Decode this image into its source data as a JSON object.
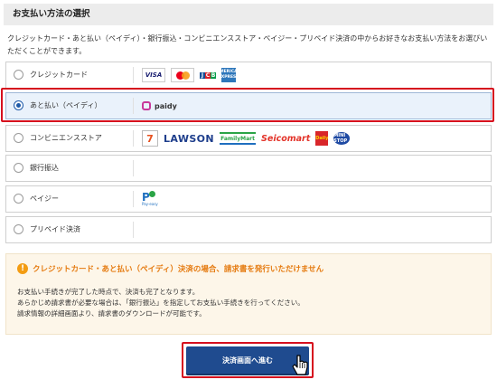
{
  "header": {
    "title": "お支払い方法の選択"
  },
  "intro": "クレジットカード・あと払い（ペイディ）・銀行振込・コンビニエンスストア・ペイジー・プリペイド決済の中からお好きなお支払い方法をお選びいただくことができます。",
  "options": [
    {
      "label": "クレジットカード",
      "selected": false,
      "logos": [
        "visa-logo",
        "mastercard-logo",
        "jcb-logo",
        "amex-logo"
      ]
    },
    {
      "label": "あと払い（ペイディ）",
      "selected": true,
      "logos": [
        "paidy-logo"
      ]
    },
    {
      "label": "コンビニエンスストア",
      "selected": false,
      "logos": [
        "seven-eleven-logo",
        "lawson-logo",
        "familymart-logo",
        "seicomart-logo",
        "daily-yamazaki-logo",
        "ministop-logo"
      ]
    },
    {
      "label": "銀行振込",
      "selected": false,
      "logos": []
    },
    {
      "label": "ペイジー",
      "selected": false,
      "logos": [
        "payeasy-logo"
      ]
    },
    {
      "label": "プリペイド決済",
      "selected": false,
      "logos": []
    }
  ],
  "logo_text": {
    "visa": "VISA",
    "jcb": [
      "J",
      "C",
      "B"
    ],
    "amex": [
      "AMERICAN",
      "EXPRESS"
    ],
    "paidy": "paidy",
    "seven": "7",
    "lawson": "LAWSON",
    "familymart": "FamilyMart",
    "seicomart": "Seicomart",
    "daily": "Daily",
    "ministop": "MINI STOP",
    "payeasy": "Pay-easy"
  },
  "notice": {
    "title": "クレジットカード・あと払い（ペイディ）決済の場合、請求書を発行いただけません",
    "lines": [
      "お支払い手続きが完了した時点で、決済も完了となります。",
      "あらかじめ請求書が必要な場合は、「銀行振込」を指定してお支払い手続きを行ってください。",
      "請求情報の詳細画面より、請求書のダウンロードが可能です。"
    ]
  },
  "cta": {
    "label": "決済画面へ進む"
  },
  "colors": {
    "accent": "#1f4b8f",
    "highlight": "#d60f1e",
    "warning": "#e57a0f"
  }
}
